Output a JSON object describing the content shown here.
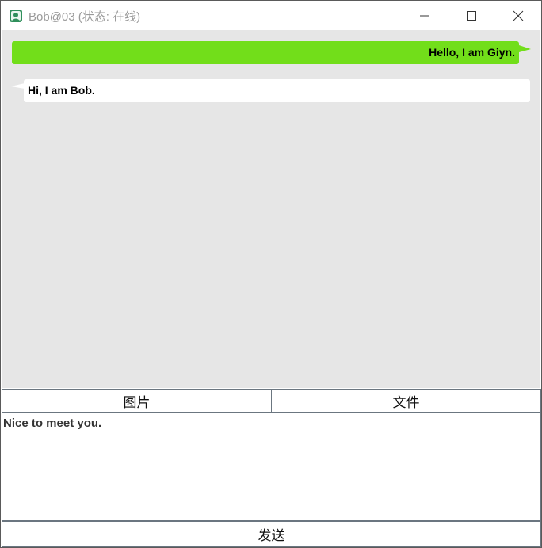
{
  "window": {
    "title": "Bob@03 (状态: 在线)"
  },
  "chat": {
    "messages": [
      {
        "direction": "outgoing",
        "text": "Hello, I am Giyn.",
        "color": "#72de1a"
      },
      {
        "direction": "incoming",
        "text": "Hi, I am Bob.",
        "color": "#ffffff"
      }
    ]
  },
  "toolbar": {
    "image_label": "图片",
    "file_label": "文件"
  },
  "composer": {
    "text": "Nice to meet you."
  },
  "send": {
    "label": "发送"
  },
  "icons": {
    "app": "app-icon",
    "minimize": "minimize-icon",
    "maximize": "maximize-icon",
    "close": "close-icon"
  },
  "colors": {
    "outgoing_bubble": "#72de1a",
    "incoming_bubble": "#ffffff",
    "chat_background": "#e6e6e6"
  }
}
